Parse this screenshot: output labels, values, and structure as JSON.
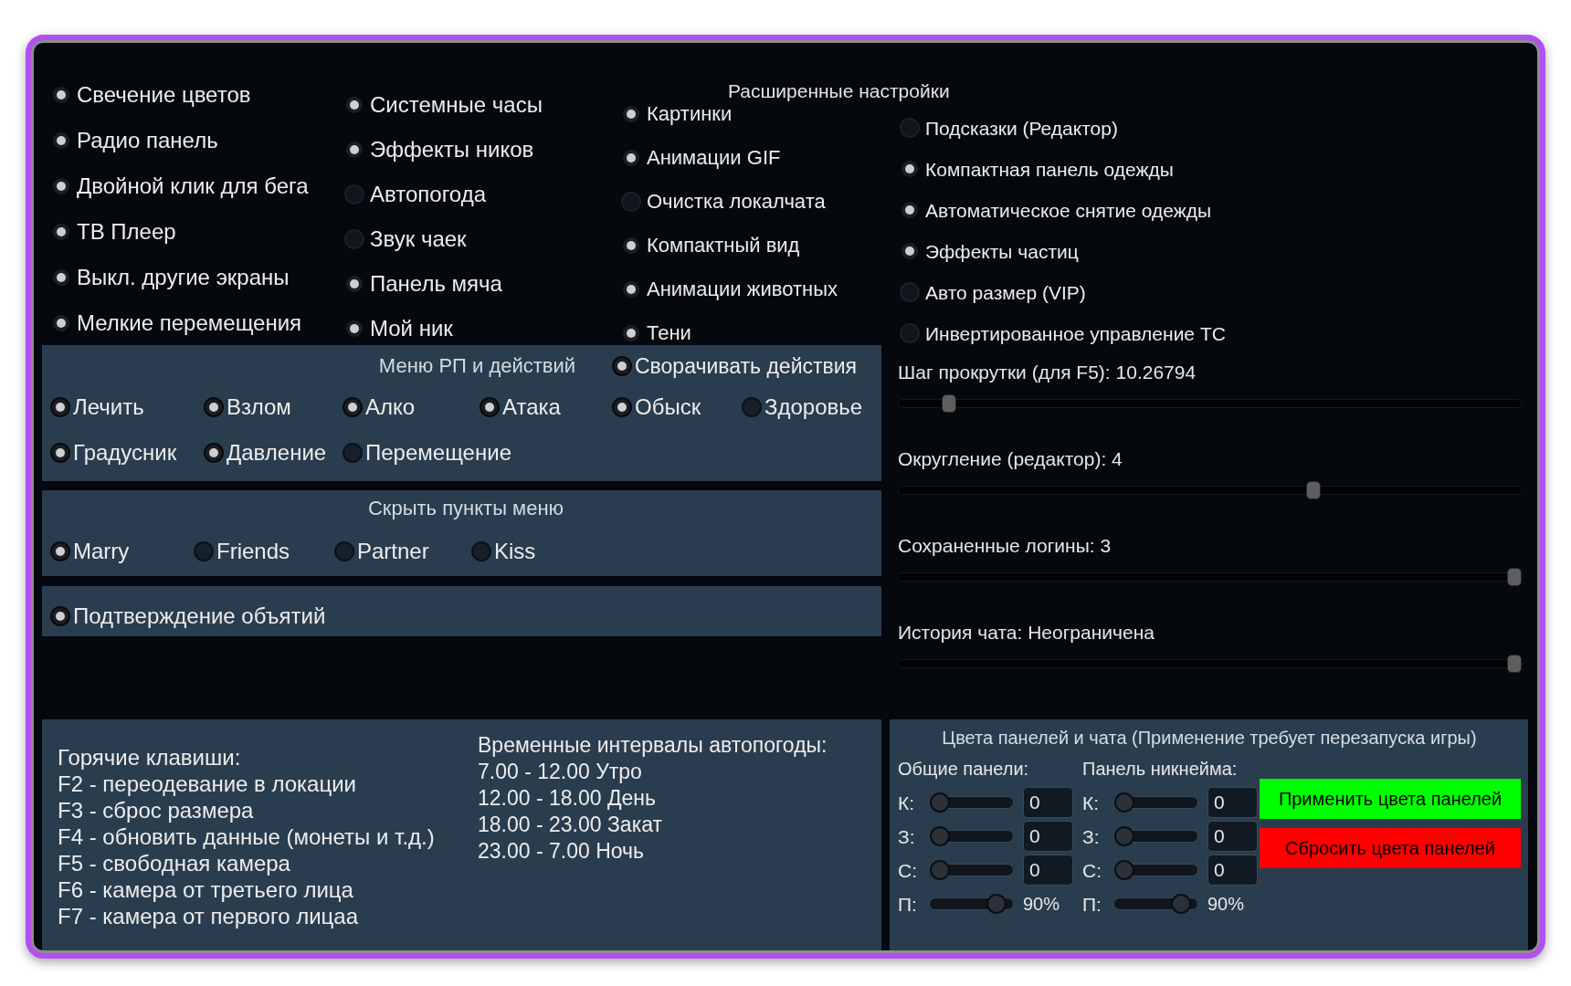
{
  "advanced_settings_title": "Расширенные настройки",
  "option_columns": [
    {
      "options": [
        {
          "label": "Свечение цветов",
          "checked": true
        },
        {
          "label": "Радио панель",
          "checked": true
        },
        {
          "label": "Двойной клик для бега",
          "checked": true
        },
        {
          "label": "ТВ Плеер",
          "checked": true
        },
        {
          "label": "Выкл. другие экраны",
          "checked": true
        },
        {
          "label": "Мелкие перемещения",
          "checked": true
        }
      ]
    },
    {
      "options": [
        {
          "label": "Системные часы",
          "checked": true
        },
        {
          "label": "Эффекты ников",
          "checked": true
        },
        {
          "label": "Автопогода",
          "checked": false
        },
        {
          "label": "Звук чаек",
          "checked": false
        },
        {
          "label": "Панель мяча",
          "checked": true
        },
        {
          "label": "Мой ник",
          "checked": true
        }
      ]
    },
    {
      "options": [
        {
          "label": "Картинки",
          "checked": true
        },
        {
          "label": "Анимации GIF",
          "checked": true
        },
        {
          "label": "Очистка локалчата",
          "checked": false
        },
        {
          "label": "Компактный вид",
          "checked": true
        },
        {
          "label": "Анимации животных",
          "checked": true
        },
        {
          "label": "Тени",
          "checked": true
        }
      ]
    },
    {
      "options": [
        {
          "label": "Подсказки (Редактор)",
          "checked": false
        },
        {
          "label": "Компактная панель одежды",
          "checked": true
        },
        {
          "label": "Автоматическое снятие одежды",
          "checked": true
        },
        {
          "label": "Эффекты частиц",
          "checked": true
        },
        {
          "label": "Авто размер (VIP)",
          "checked": false
        },
        {
          "label": "Инвертированное управление ТС",
          "checked": false
        }
      ]
    }
  ],
  "rp_menu": {
    "title": "Меню РП и действий",
    "collapse_option": {
      "label": "Сворачивать действия",
      "checked": true
    },
    "options": [
      {
        "label": "Лечить",
        "checked": true
      },
      {
        "label": "Взлом",
        "checked": true
      },
      {
        "label": "Алко",
        "checked": true
      },
      {
        "label": "Атака",
        "checked": true
      },
      {
        "label": "Обыск",
        "checked": true
      },
      {
        "label": "Здоровье",
        "checked": false
      },
      {
        "label": "Градусник",
        "checked": true
      },
      {
        "label": "Давление",
        "checked": true
      },
      {
        "label": "Перемещение",
        "checked": false
      }
    ]
  },
  "hidden_menu_items": {
    "title": "Скрыть пункты меню",
    "options": [
      {
        "label": "Marry",
        "checked": true
      },
      {
        "label": "Friends",
        "checked": false
      },
      {
        "label": "Partner",
        "checked": false
      },
      {
        "label": "Kiss",
        "checked": false
      }
    ]
  },
  "hug_confirmation": {
    "label": "Подтверждение объятий",
    "checked": true
  },
  "sliders": [
    {
      "label": "Шаг прокрутки (для F5): 10.26794",
      "level": 0.07
    },
    {
      "label": "Округление (редактор): 4",
      "level": 0.67
    },
    {
      "label": "Сохраненные логины: 3",
      "level": 1
    },
    {
      "label": "История чата: Неограничена",
      "level": 1
    }
  ],
  "hotkeys": {
    "title": "Горячие клавиши:",
    "lines": [
      "F2 - переодевание в локации",
      "F3 - сброс размера",
      "F4 - обновить данные (монеты и т.д.)",
      "F5 - свободная камера",
      "F6 - камера от третьего лица",
      "F7 - камера от первого лицаа"
    ]
  },
  "autoweather": {
    "title": "Временные интервалы автопогоды:",
    "lines": [
      "7.00 - 12.00 Утро",
      "12.00 - 18.00 День",
      "18.00 - 23.00 Закат",
      "23.00 - 7.00 Ночь"
    ]
  },
  "panel_colors": {
    "title": "Цвета панелей и чата (Применение требует перезапуска игры)",
    "groups": [
      {
        "title": "Общие панели:",
        "channels": [
          {
            "kind": "field",
            "label": "К:",
            "level": 0,
            "value": "0"
          },
          {
            "kind": "field",
            "label": "З:",
            "level": 0,
            "value": "0"
          },
          {
            "kind": "field",
            "label": "С:",
            "level": 0,
            "value": "0"
          },
          {
            "kind": "percent",
            "label": "П:",
            "level": 0.9,
            "reading": "90%"
          }
        ]
      },
      {
        "title": "Панель никнейма:",
        "channels": [
          {
            "kind": "field",
            "label": "К:",
            "level": 0,
            "value": "0"
          },
          {
            "kind": "field",
            "label": "З:",
            "level": 0,
            "value": "0"
          },
          {
            "kind": "field",
            "label": "С:",
            "level": 0,
            "value": "0"
          },
          {
            "kind": "percent",
            "label": "П:",
            "level": 0.9,
            "reading": "90%"
          }
        ]
      }
    ],
    "buttons": [
      {
        "label": "Применить цвета панелей",
        "color": "#00ff00"
      },
      {
        "label": "Сбросить цвета панелей",
        "color": "#ff0000"
      }
    ]
  }
}
